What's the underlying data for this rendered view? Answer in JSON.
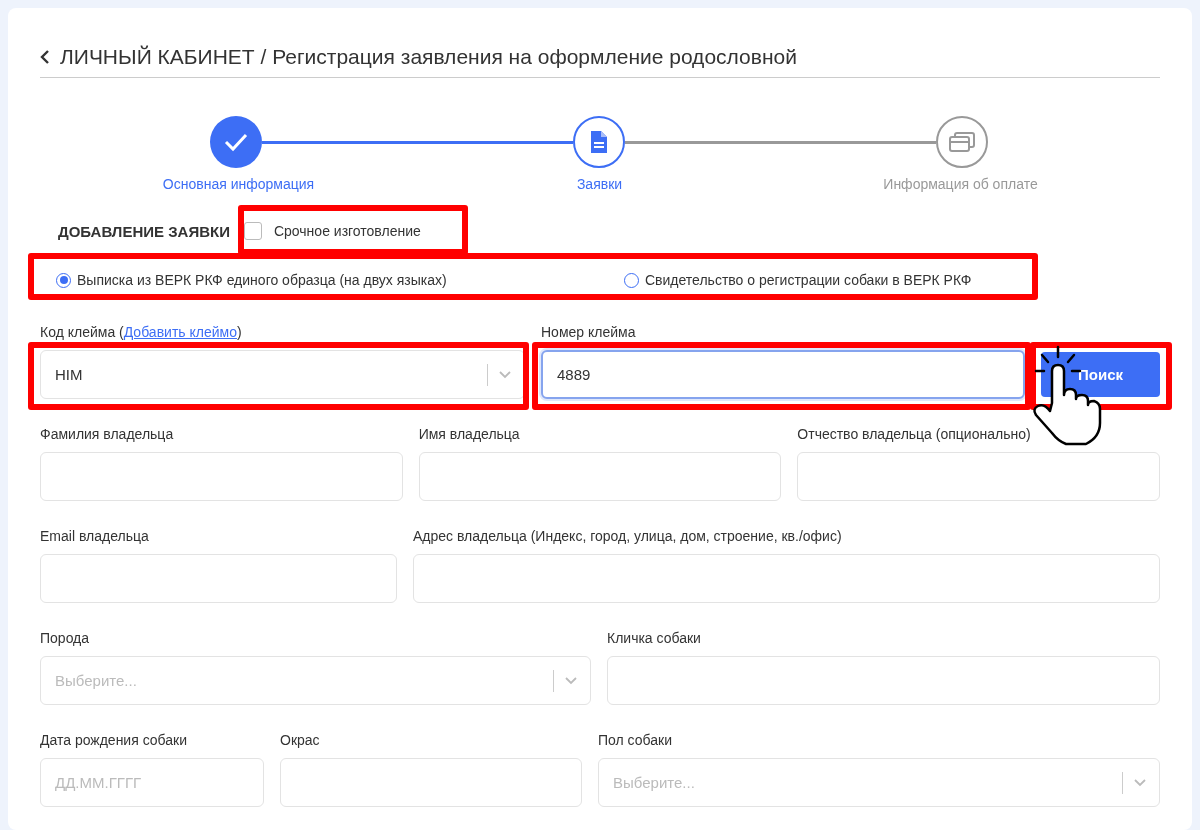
{
  "title": "ЛИЧНЫЙ КАБИНЕТ / Регистрация заявления на оформление родословной",
  "steps": [
    {
      "label": "Основная информация",
      "kind": "done"
    },
    {
      "label": "Заявки",
      "kind": "current"
    },
    {
      "label": "Информация об оплате",
      "kind": "pending"
    }
  ],
  "section": {
    "title": "ДОБАВЛЕНИЕ ЗАЯВКИ",
    "urgent": {
      "label": "Срочное изготовление",
      "checked": false
    }
  },
  "document_types": [
    {
      "label": "Выписка из ВЕРК РКФ единого образца (на двух языках)",
      "selected": true
    },
    {
      "label": "Свидетельство о регистрации собаки в ВЕРК РКФ",
      "selected": false
    }
  ],
  "rows": [
    {
      "fields": [
        {
          "kind": "select",
          "label": "Код клейма (",
          "link": "Добавить клеймо",
          "label_end": ")",
          "value": "HIM"
        },
        {
          "kind": "text",
          "label": "Номер клейма",
          "value": "4889",
          "focused": true
        },
        {
          "kind": "button",
          "text": "Поиск"
        }
      ]
    },
    {
      "fields": [
        {
          "kind": "text",
          "label": "Фамилия владельца"
        },
        {
          "kind": "text",
          "label": "Имя владельца"
        },
        {
          "kind": "text",
          "label": "Отчество владельца (опционально)"
        }
      ]
    },
    {
      "fields": [
        {
          "kind": "text",
          "label": "Email владельца"
        },
        {
          "kind": "text",
          "label": "Адрес владельца (Индекс, город, улица, дом, строение, кв./офис)"
        }
      ]
    },
    {
      "fields": [
        {
          "kind": "select",
          "label": "Порода",
          "placeholder": "Выберите..."
        },
        {
          "kind": "text",
          "label": "Кличка собаки"
        }
      ]
    },
    {
      "fields": [
        {
          "kind": "text",
          "label": "Дата рождения собаки",
          "placeholder": "ДД.ММ.ГГГГ"
        },
        {
          "kind": "text",
          "label": "Окрас"
        },
        {
          "kind": "select",
          "label": "Пол собаки",
          "placeholder": "Выберите..."
        }
      ]
    }
  ]
}
